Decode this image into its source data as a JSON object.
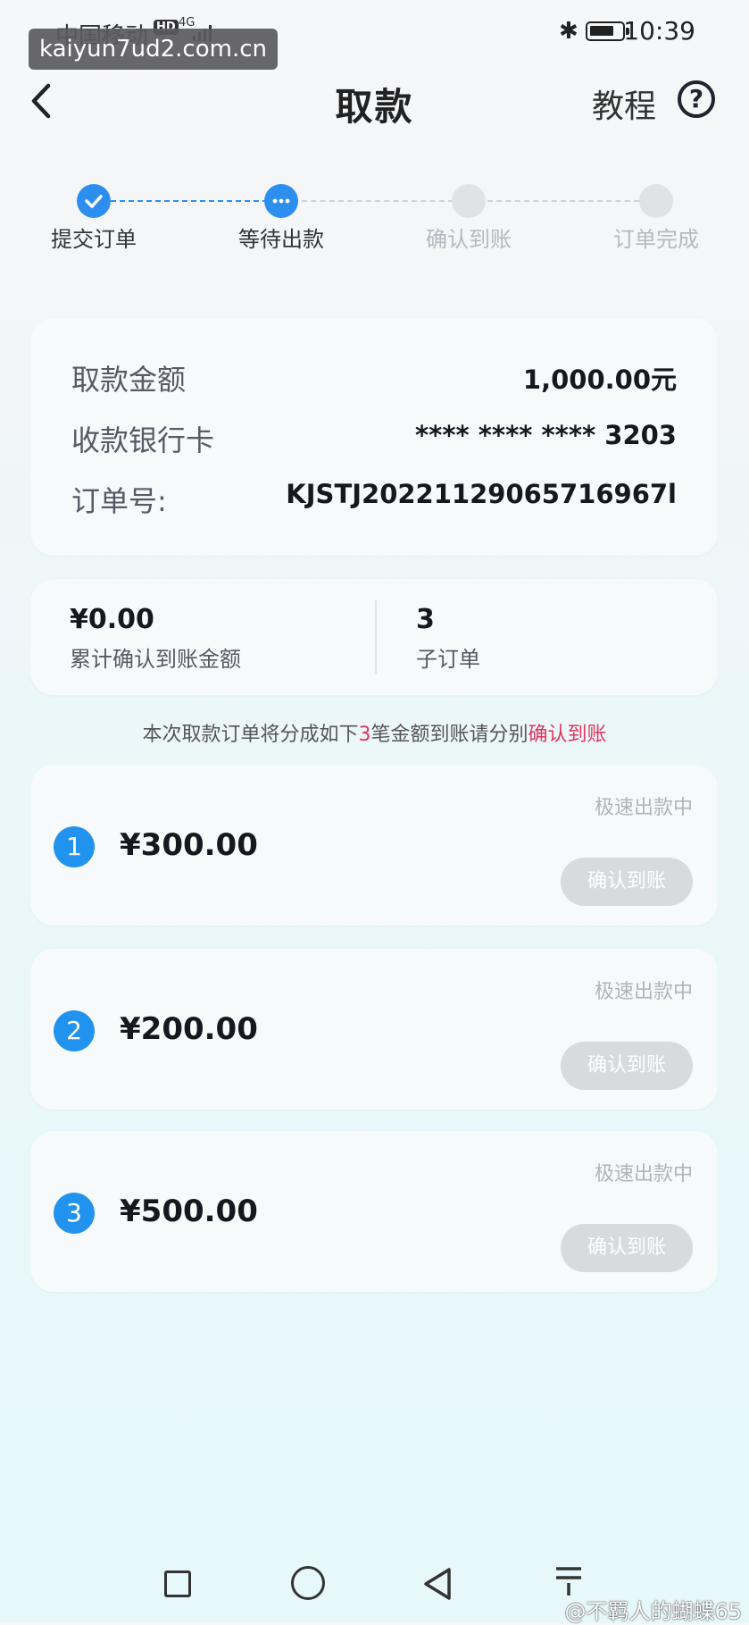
{
  "status_bar": {
    "carrier": "中国移动",
    "hd_badge": "HD",
    "signal_label": "4G",
    "time": "10:39",
    "bluetooth_icon": "bluetooth-icon",
    "battery_icon": "battery-icon"
  },
  "watermark_url": "kaiyun7ud2.com.cn",
  "header": {
    "title": "取款",
    "tutorial_label": "教程",
    "help_symbol": "?"
  },
  "steps": [
    {
      "label": "提交订单",
      "state": "done"
    },
    {
      "label": "等待出款",
      "state": "current"
    },
    {
      "label": "确认到账",
      "state": "pending"
    },
    {
      "label": "订单完成",
      "state": "pending"
    }
  ],
  "details": {
    "amount_label": "取款金额",
    "amount_value": "1,000.00元",
    "card_label": "收款银行卡",
    "card_value": "**** **** **** 3203",
    "order_label": "订单号:",
    "order_value": "KJSTJ20221129065716967l"
  },
  "summary": {
    "confirmed_value": "¥0.00",
    "confirmed_label": "累计确认到账金额",
    "suborder_count": "3",
    "suborder_label": "子订单"
  },
  "note": {
    "prefix": "本次取款订单将分成如下",
    "count": "3",
    "middle": "笔金额到账请分别",
    "link": "确认到账"
  },
  "suborders": [
    {
      "index": "1",
      "amount": "¥300.00",
      "status": "极速出款中",
      "button": "确认到账"
    },
    {
      "index": "2",
      "amount": "¥200.00",
      "status": "极速出款中",
      "button": "确认到账"
    },
    {
      "index": "3",
      "amount": "¥500.00",
      "status": "极速出款中",
      "button": "确认到账"
    }
  ],
  "credit": "@不羁人的蝴蝶65",
  "colors": {
    "accent": "#2c8ff0",
    "highlight_red": "#e0355d",
    "disabled_button": "#d8dadd"
  }
}
